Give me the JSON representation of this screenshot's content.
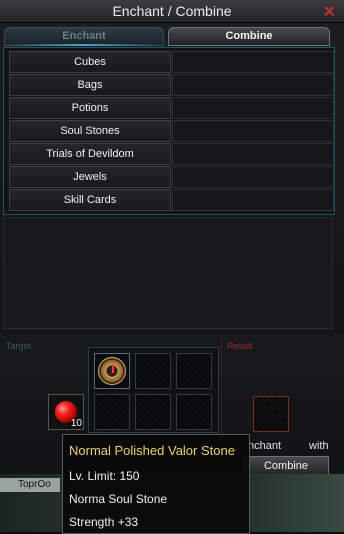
{
  "window": {
    "title": "Enchant / Combine",
    "close_glyph": "✕"
  },
  "tabs": [
    {
      "label": "Enchant"
    },
    {
      "label": "Combine"
    }
  ],
  "categories": [
    {
      "label": "Cubes"
    },
    {
      "label": "Bags"
    },
    {
      "label": "Potions"
    },
    {
      "label": "Soul Stones"
    },
    {
      "label": "Trials of Devildom"
    },
    {
      "label": "Jewels"
    },
    {
      "label": "Skill Cards"
    }
  ],
  "lower": {
    "target_label": "Target",
    "result_label": "Result",
    "target_item_count": "10",
    "enchant_label": "nchant",
    "with_label": "with",
    "combine_button": "Combine",
    "grid_first_item": "clock-icon"
  },
  "background": {
    "strip_text": "ToprOo"
  },
  "tooltip": {
    "title": "Normal Polished Valor Stone",
    "lines": [
      "Lv. Limit: 150",
      "Norma Soul Stone",
      "Strength +33"
    ]
  },
  "colors": {
    "accent": "#4ea2c9",
    "title": "#e6d37a",
    "close": "#c03030"
  }
}
